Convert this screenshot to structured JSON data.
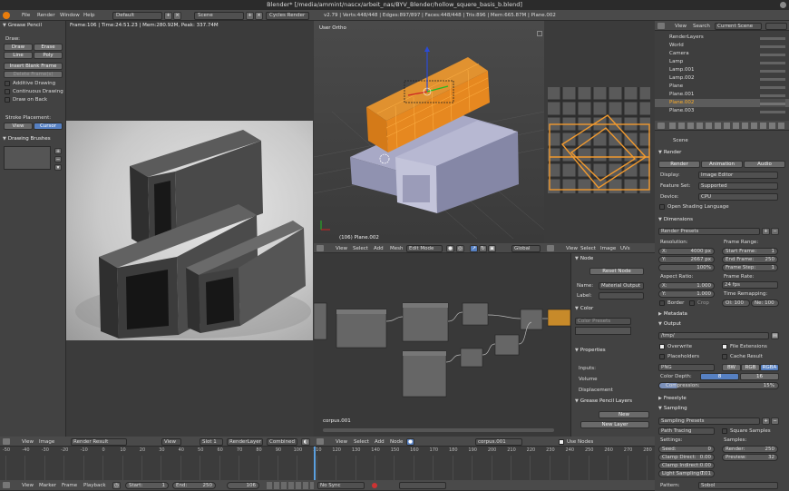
{
  "titlebar": {
    "title": "Blender* [/media/ammint/nascx/arbeit_nas/BYV_Blender/hollow_squere_basis_b.blend]"
  },
  "topmenu": {
    "file": "File",
    "render": "Render",
    "window": "Window",
    "help": "Help",
    "layout": "Default",
    "scene": "Scene",
    "engine": "Cycles Render",
    "stats": "v2.79 | Verts:448/448 | Edges:897/897 | Faces:448/448 | Tris:896 | Mem:665.87M | Plane.002"
  },
  "gp": {
    "title": "Grease Pencil",
    "draw_label": "Draw:",
    "draw": "Draw",
    "erase": "Erase",
    "line": "Line",
    "poly": "Poly",
    "insert": "Insert Blank Frame",
    "delete": "Delete Frame(s)",
    "additive": "Additive Drawing",
    "continuous": "Continuous Drawing",
    "drawback": "Draw on Back",
    "stroke_label": "Stroke Placement:",
    "view": "View",
    "cursor": "Cursor",
    "brushes": "Drawing Brushes"
  },
  "render_view": {
    "info": "Frame:106 | Time:24:51.23 | Mem:280.92M, Peak: 337.74M"
  },
  "viewport": {
    "label": "User Ortho",
    "object": "(106) Plane.002",
    "mode": "Edit Mode",
    "orient": "Global",
    "menu": [
      "View",
      "Select",
      "Add",
      "Mesh"
    ]
  },
  "uv": {
    "menu": [
      "View",
      "Select",
      "Image",
      "UVs"
    ]
  },
  "node_editor": {
    "menu": [
      "View",
      "Select",
      "Add",
      "Node"
    ],
    "material": "corpus.001",
    "use_nodes": "Use Nodes",
    "tree_label": "corpus.001"
  },
  "node_props": {
    "node": "Node",
    "reset": "Reset Node",
    "name_label": "Name:",
    "name": "Material Output",
    "label_label": "Label:",
    "color": "Color",
    "color_presets": "Color Presets",
    "properties": "Properties",
    "inputs": [
      "Inputs:",
      "Volume",
      "Displacement"
    ],
    "gpl": "Grease Pencil Layers",
    "new": "New",
    "new_layer": "New Layer"
  },
  "outliner": {
    "menu": [
      "View",
      "Search"
    ],
    "scene": "Current Scene",
    "items": [
      "RenderLayers",
      "World",
      "Camera",
      "Lamp",
      "Lamp.001",
      "Lamp.002",
      "Plane",
      "Plane.001",
      "Plane.002",
      "Plane.003"
    ]
  },
  "props": {
    "scene": "Scene",
    "render": "Render",
    "r_render": "Render",
    "animation": "Animation",
    "audio": "Audio",
    "display_label": "Display:",
    "display": "Image Editor",
    "feature_label": "Feature Set:",
    "feature": "Supported",
    "device_label": "Device:",
    "device": "CPU",
    "osl": "Open Shading Language",
    "dimensions": "Dimensions",
    "render_presets": "Render Presets",
    "resolution": "Resolution:",
    "res_x": "X:",
    "res_x_val": "4000 px",
    "res_y": "Y:",
    "res_y_val": "2667 px",
    "res_pct": "100%",
    "frame_range": "Frame Range:",
    "start_frame": "Start Frame:",
    "start_val": "1",
    "end_frame": "End Frame:",
    "end_val": "250",
    "frame_step": "Frame Step:",
    "step_val": "1",
    "aspect": "Aspect Ratio:",
    "asp_x": "X:",
    "asp_x_val": "1.000",
    "asp_y": "Y:",
    "asp_y_val": "1.000",
    "frame_rate": "Frame Rate:",
    "fps": "24 fps",
    "border": "Border",
    "crop": "Crop",
    "time_remap": "Time Remapping:",
    "old": "Ol: 100",
    "new": "Ne: 100",
    "metadata": "Metadata",
    "output": "Output",
    "path": "/tmp/",
    "overwrite": "Overwrite",
    "file_ext": "File Extensions",
    "placeholders": "Placeholders",
    "cache": "Cache Result",
    "format": "PNG",
    "bw": "BW",
    "rgb": "RGB",
    "rgba": "RGBA",
    "color_depth": "Color Depth:",
    "d8": "8",
    "d16": "16",
    "compression": "Compression:",
    "comp_val": "15%",
    "freestyle": "Freestyle",
    "sampling": "Sampling",
    "sampling_presets": "Sampling Presets",
    "path_tracing": "Path Tracing",
    "square": "Square Samples",
    "settings": "Settings:",
    "samples": "Samples:",
    "seed": "Seed:",
    "seed_val": "0",
    "clamp_d": "Clamp Direct:",
    "clamp_d_val": "0.00",
    "clamp_i": "Clamp Indirect:",
    "clamp_i_val": "0.00",
    "light_sampling": "Light Sampling T:",
    "ls_val": "0.01",
    "render_s": "Render:",
    "render_s_val": "250",
    "preview_s": "Preview:",
    "preview_s_val": "32",
    "pattern": "Pattern:",
    "sobol": "Sobol"
  },
  "image_editor": {
    "menu": [
      "View",
      "Image"
    ],
    "image": "Render Result",
    "view": "View",
    "slot": "Slot 1",
    "layer": "RenderLayer",
    "pass": "Combined"
  },
  "timeline": {
    "menu": [
      "View",
      "Marker",
      "Frame",
      "Playback"
    ],
    "start": "Start:",
    "start_val": "1",
    "end": "End:",
    "end_val": "250",
    "current": "106",
    "sync": "No Sync",
    "ticks": [
      "-50",
      "-40",
      "-30",
      "-20",
      "-10",
      "0",
      "10",
      "20",
      "30",
      "40",
      "50",
      "60",
      "70",
      "80",
      "90",
      "100",
      "110",
      "120",
      "130",
      "140",
      "150",
      "160",
      "170",
      "180",
      "190",
      "200",
      "210",
      "220",
      "230",
      "240",
      "250",
      "260",
      "270",
      "280"
    ]
  }
}
